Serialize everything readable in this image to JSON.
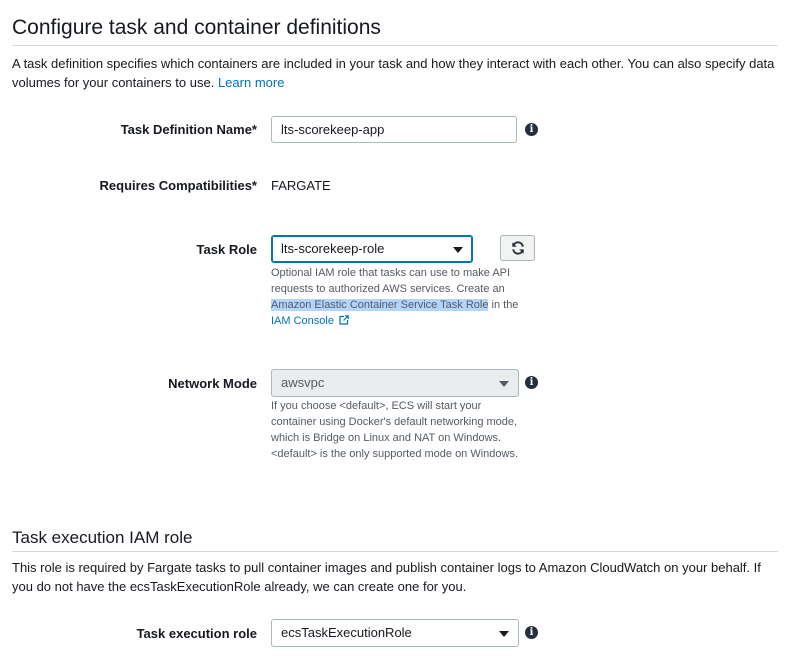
{
  "section1": {
    "title": "Configure task and container definitions",
    "description": "A task definition specifies which containers are included in your task and how they interact with each other. You can also specify data volumes for your containers to use.",
    "learn_more": "Learn more"
  },
  "task_definition_name": {
    "label": "Task Definition Name*",
    "value": "lts-scorekeep-app"
  },
  "requires_compatibilities": {
    "label": "Requires Compatibilities*",
    "value": "FARGATE"
  },
  "task_role": {
    "label": "Task Role",
    "selected": "lts-scorekeep-role",
    "help_prefix": "Optional IAM role that tasks can use to make API requests to authorized AWS services. Create an",
    "help_highlight": "Amazon Elastic Container Service Task Role",
    "help_suffix": "in the",
    "help_link": "IAM Console"
  },
  "network_mode": {
    "label": "Network Mode",
    "selected": "awsvpc",
    "help": "If you choose <default>, ECS will start your container using Docker's default networking mode, which is Bridge on Linux and NAT on Windows. <default> is the only supported mode on Windows."
  },
  "section2": {
    "title": "Task execution IAM role",
    "description": "This role is required by Fargate tasks to pull container images and publish container logs to Amazon CloudWatch on your behalf. If you do not have the ecsTaskExecutionRole already, we can create one for you."
  },
  "task_execution_role": {
    "label": "Task execution role",
    "selected": "ecsTaskExecutionRole"
  },
  "icons": {
    "info": "info-icon",
    "refresh": "refresh-icon",
    "external": "external-link-icon",
    "dropdown": "chevron-down-icon"
  }
}
